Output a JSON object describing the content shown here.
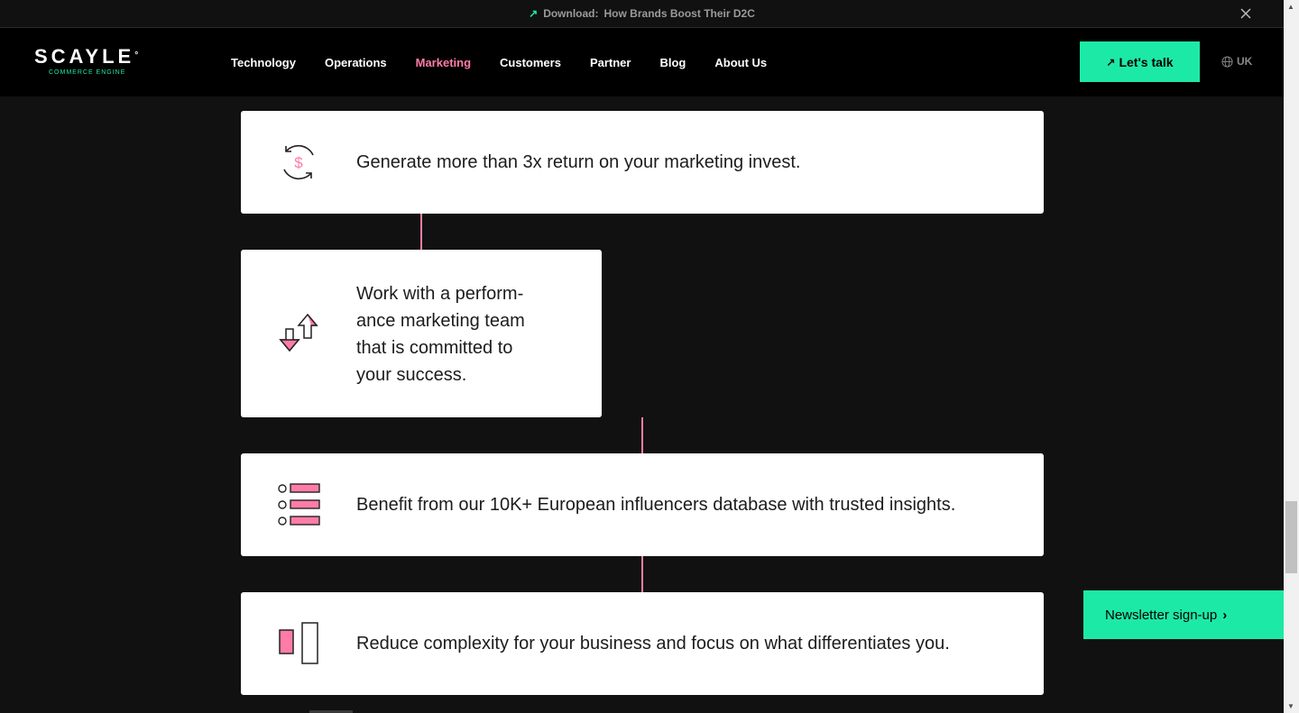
{
  "banner": {
    "label": "Download:",
    "title": "How Brands Boost Their D2C",
    "arrow_icon": "arrow-up-right-icon",
    "close_icon": "close-icon"
  },
  "nav": {
    "logo_word": "SCAYLE",
    "logo_sub": "COMMERCE ENGINE",
    "items": [
      {
        "label": "Technology"
      },
      {
        "label": "Operations"
      },
      {
        "label": "Marketing",
        "active": true
      },
      {
        "label": "Customers"
      },
      {
        "label": "Partner"
      },
      {
        "label": "Blog"
      },
      {
        "label": "About Us"
      }
    ],
    "cta_label": "Let's talk",
    "locale": "UK"
  },
  "cards": [
    {
      "text": "Generate more than 3x return on your marketing invest.",
      "icon": "dollar-cycle-icon"
    },
    {
      "text": "Work with a perform-ance marketing team that is committed to your success.",
      "icon": "up-down-arrows-icon"
    },
    {
      "text": "Benefit from our 10K+ European influencers database with trusted insights.",
      "icon": "list-icon"
    },
    {
      "text": "Reduce complexity for your business and focus on what differentiates you.",
      "icon": "columns-icon"
    }
  ],
  "card_lines": {
    "card2": [
      "Work with a perform-",
      "ance marketing team",
      "that is committed to",
      "your success."
    ]
  },
  "newsletter": {
    "label": "Newsletter sign-up"
  },
  "colors": {
    "accent_green": "#1de9a6",
    "accent_pink": "#ff7ca8",
    "background": "#111111"
  }
}
